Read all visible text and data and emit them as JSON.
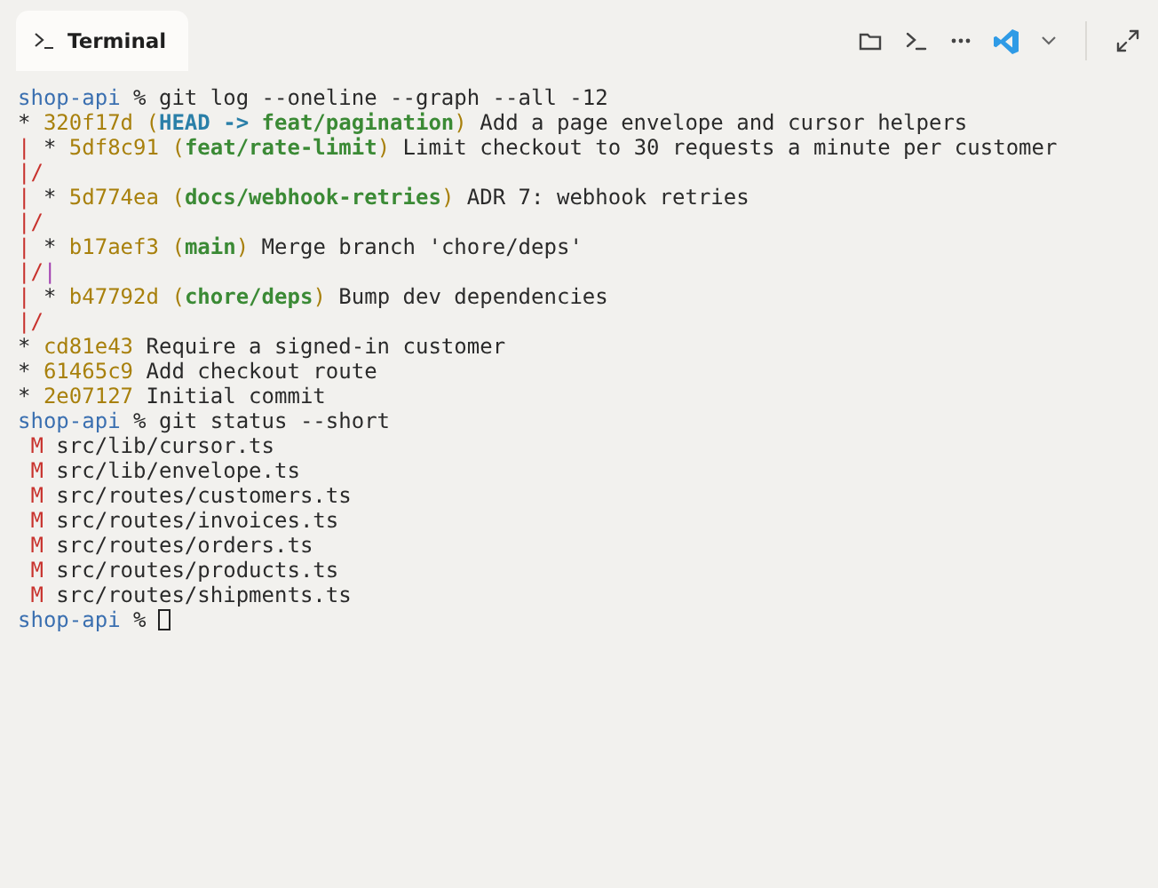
{
  "tab": {
    "title": "Terminal",
    "selected": true
  },
  "lines": [
    {
      "segments": [
        {
          "kind": "prompt",
          "text": "shop-api"
        },
        {
          "kind": "command",
          "text": " % git log --oneline --graph --all -12"
        }
      ]
    },
    {
      "segments": [
        {
          "kind": "graph",
          "text": "*",
          "color": "#2a2a2a"
        },
        {
          "kind": "hash",
          "text": " 320f17d"
        },
        {
          "kind": "paren",
          "text": " ("
        },
        {
          "kind": "head",
          "text": "HEAD ->"
        },
        {
          "kind": "branch",
          "text": " feat/pagination"
        },
        {
          "kind": "paren",
          "text": ")"
        },
        {
          "kind": "message",
          "text": " Add a page envelope and cursor helpers"
        }
      ]
    },
    {
      "segments": [
        {
          "kind": "graph",
          "text": "|",
          "color": "#c8322d"
        },
        {
          "kind": "graph",
          "text": " *",
          "color": "#2a2a2a"
        },
        {
          "kind": "hash",
          "text": " 5df8c91"
        },
        {
          "kind": "paren",
          "text": " ("
        },
        {
          "kind": "branch",
          "text": "feat/rate-limit"
        },
        {
          "kind": "paren",
          "text": ")"
        },
        {
          "kind": "message",
          "text": " Limit checkout to 30 requests a minute per customer"
        }
      ]
    },
    {
      "segments": [
        {
          "kind": "graph",
          "text": "|/",
          "color": "#c8322d"
        }
      ]
    },
    {
      "segments": [
        {
          "kind": "graph",
          "text": "|",
          "color": "#c8322d"
        },
        {
          "kind": "graph",
          "text": " *",
          "color": "#2a2a2a"
        },
        {
          "kind": "hash",
          "text": " 5d774ea"
        },
        {
          "kind": "paren",
          "text": " ("
        },
        {
          "kind": "branch",
          "text": "docs/webhook-retries"
        },
        {
          "kind": "paren",
          "text": ")"
        },
        {
          "kind": "message",
          "text": " ADR 7: webhook retries"
        }
      ]
    },
    {
      "segments": [
        {
          "kind": "graph",
          "text": "|/",
          "color": "#c8322d"
        }
      ]
    },
    {
      "segments": [
        {
          "kind": "graph",
          "text": "|",
          "color": "#c8322d"
        },
        {
          "kind": "graph",
          "text": " *",
          "color": "#2a2a2a"
        },
        {
          "kind": "hash",
          "text": " b17aef3"
        },
        {
          "kind": "paren",
          "text": " ("
        },
        {
          "kind": "branch",
          "text": "main"
        },
        {
          "kind": "paren",
          "text": ")"
        },
        {
          "kind": "message",
          "text": " Merge branch 'chore/deps'"
        }
      ]
    },
    {
      "segments": [
        {
          "kind": "graph",
          "text": "|/",
          "color": "#c8322d"
        },
        {
          "kind": "graph",
          "text": "|",
          "color": "#a23fb0"
        }
      ]
    },
    {
      "segments": [
        {
          "kind": "graph",
          "text": "|",
          "color": "#c8322d"
        },
        {
          "kind": "graph",
          "text": " *",
          "color": "#2a2a2a"
        },
        {
          "kind": "hash",
          "text": " b47792d"
        },
        {
          "kind": "paren",
          "text": " ("
        },
        {
          "kind": "branch",
          "text": "chore/deps"
        },
        {
          "kind": "paren",
          "text": ")"
        },
        {
          "kind": "message",
          "text": " Bump dev dependencies"
        }
      ]
    },
    {
      "segments": [
        {
          "kind": "graph",
          "text": "|/",
          "color": "#c8322d"
        }
      ]
    },
    {
      "segments": [
        {
          "kind": "graph",
          "text": "*",
          "color": "#2a2a2a"
        },
        {
          "kind": "hash",
          "text": " cd81e43"
        },
        {
          "kind": "message",
          "text": " Require a signed-in customer"
        }
      ]
    },
    {
      "segments": [
        {
          "kind": "graph",
          "text": "*",
          "color": "#2a2a2a"
        },
        {
          "kind": "hash",
          "text": " 61465c9"
        },
        {
          "kind": "message",
          "text": " Add checkout route"
        }
      ]
    },
    {
      "segments": [
        {
          "kind": "graph",
          "text": "*",
          "color": "#2a2a2a"
        },
        {
          "kind": "hash",
          "text": " 2e07127"
        },
        {
          "kind": "message",
          "text": " Initial commit"
        }
      ]
    },
    {
      "segments": [
        {
          "kind": "prompt",
          "text": "shop-api"
        },
        {
          "kind": "command",
          "text": " % git status --short"
        }
      ]
    },
    {
      "segments": [
        {
          "kind": "status",
          "text": " M"
        },
        {
          "kind": "path",
          "text": " src/lib/cursor.ts"
        }
      ]
    },
    {
      "segments": [
        {
          "kind": "status",
          "text": " M"
        },
        {
          "kind": "path",
          "text": " src/lib/envelope.ts"
        }
      ]
    },
    {
      "segments": [
        {
          "kind": "status",
          "text": " M"
        },
        {
          "kind": "path",
          "text": " src/routes/customers.ts"
        }
      ]
    },
    {
      "segments": [
        {
          "kind": "status",
          "text": " M"
        },
        {
          "kind": "path",
          "text": " src/routes/invoices.ts"
        }
      ]
    },
    {
      "segments": [
        {
          "kind": "status",
          "text": " M"
        },
        {
          "kind": "path",
          "text": " src/routes/orders.ts"
        }
      ]
    },
    {
      "segments": [
        {
          "kind": "status",
          "text": " M"
        },
        {
          "kind": "path",
          "text": " src/routes/products.ts"
        }
      ]
    },
    {
      "segments": [
        {
          "kind": "status",
          "text": " M"
        },
        {
          "kind": "path",
          "text": " src/routes/shipments.ts"
        }
      ]
    },
    {
      "segments": [
        {
          "kind": "prompt",
          "text": "shop-api"
        },
        {
          "kind": "command",
          "text": " %"
        },
        {
          "kind": "cursor"
        }
      ]
    }
  ]
}
